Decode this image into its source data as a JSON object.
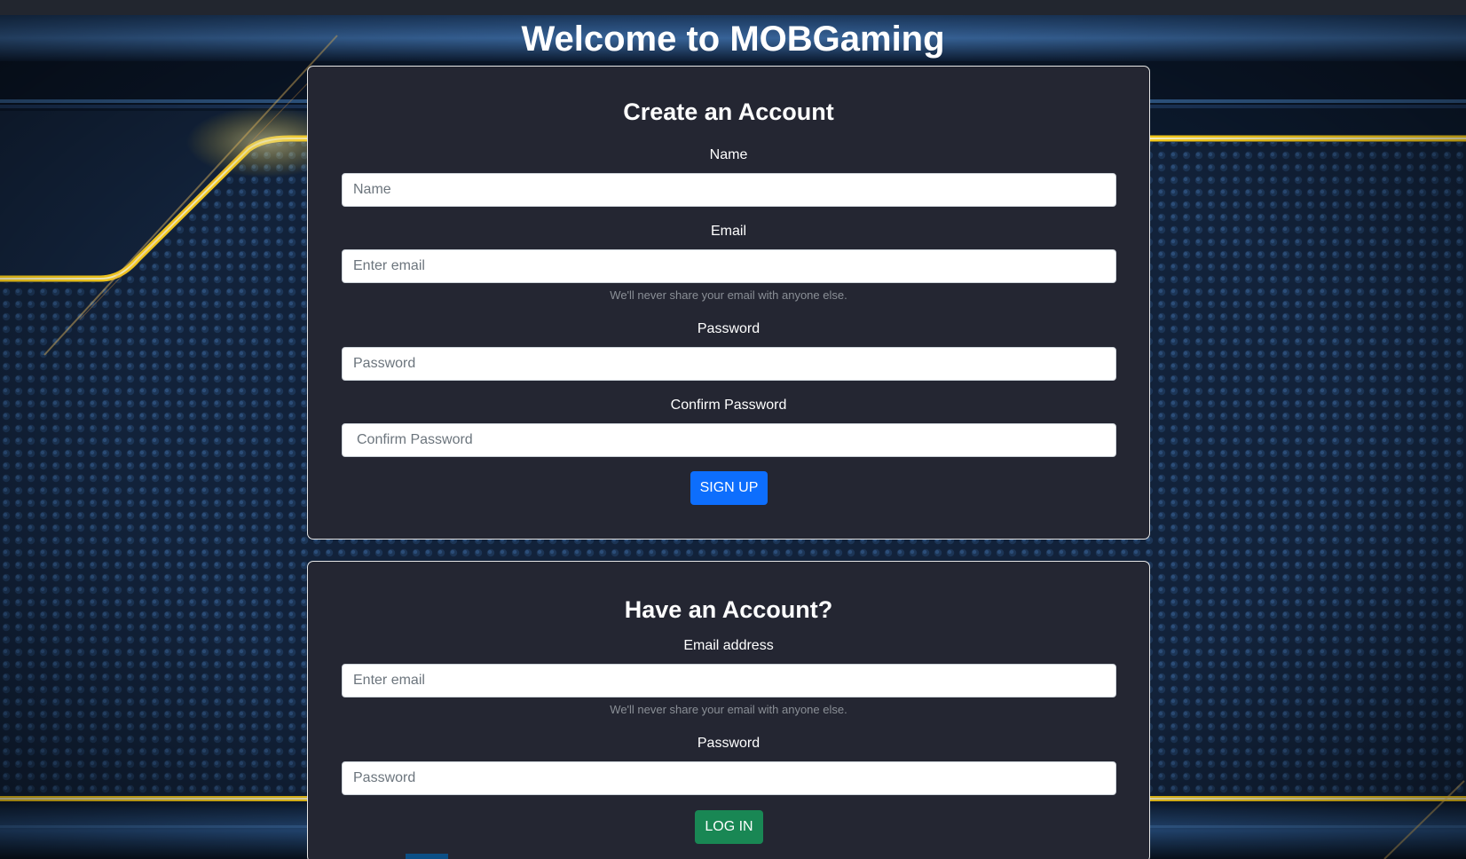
{
  "header": {
    "title": "Welcome to MOBGaming"
  },
  "signup": {
    "heading": "Create an Account",
    "name_label": "Name",
    "name_placeholder": "Name",
    "email_label": "Email",
    "email_placeholder": "Enter email",
    "email_help": "We'll never share your email with anyone else.",
    "password_label": "Password",
    "password_placeholder": "Password",
    "confirm_label": "Confirm Password",
    "confirm_placeholder": "Confirm Password",
    "submit_label": "SIGN UP"
  },
  "login": {
    "heading": "Have an Account?",
    "email_label": "Email address",
    "email_placeholder": "Enter email",
    "email_help": "We'll never share your email with anyone else.",
    "password_label": "Password",
    "password_placeholder": "Password",
    "submit_label": "LOG IN"
  },
  "colors": {
    "card_background": "#242632",
    "signup_button": "#0d6efd",
    "login_button": "#198754",
    "accent_gold": "#ffd21e"
  }
}
